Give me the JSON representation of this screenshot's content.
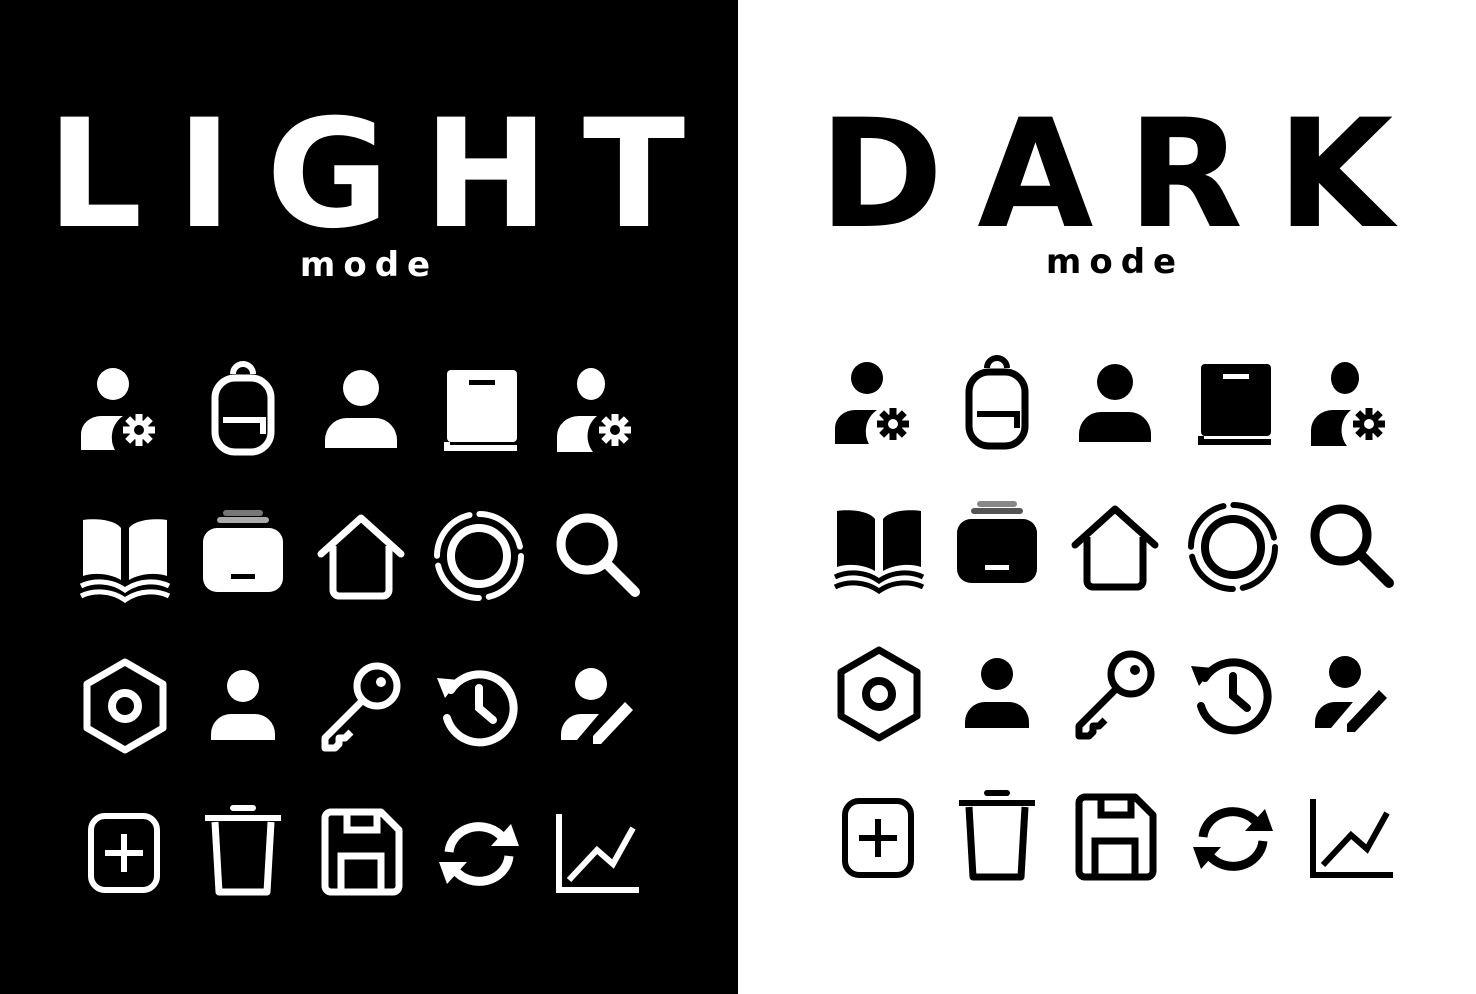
{
  "light_panel": {
    "title": "LIGHT",
    "subtitle": "mode",
    "background": "#000000",
    "foreground": "#ffffff"
  },
  "dark_panel": {
    "title": "DARK",
    "subtitle": "mode",
    "background": "#ffffff",
    "foreground": "#000000"
  },
  "icons": [
    [
      "user-settings-icon",
      "backpack-icon",
      "user-icon",
      "book-icon",
      "user-settings-outline-icon"
    ],
    [
      "open-book-icon",
      "archive-drawer-icon",
      "home-icon",
      "loading-ring-icon",
      "search-icon"
    ],
    [
      "hex-nut-icon",
      "person-icon",
      "key-icon",
      "history-icon",
      "user-edit-icon"
    ],
    [
      "add-square-icon",
      "trash-icon",
      "save-icon",
      "refresh-icon",
      "line-chart-icon"
    ]
  ]
}
